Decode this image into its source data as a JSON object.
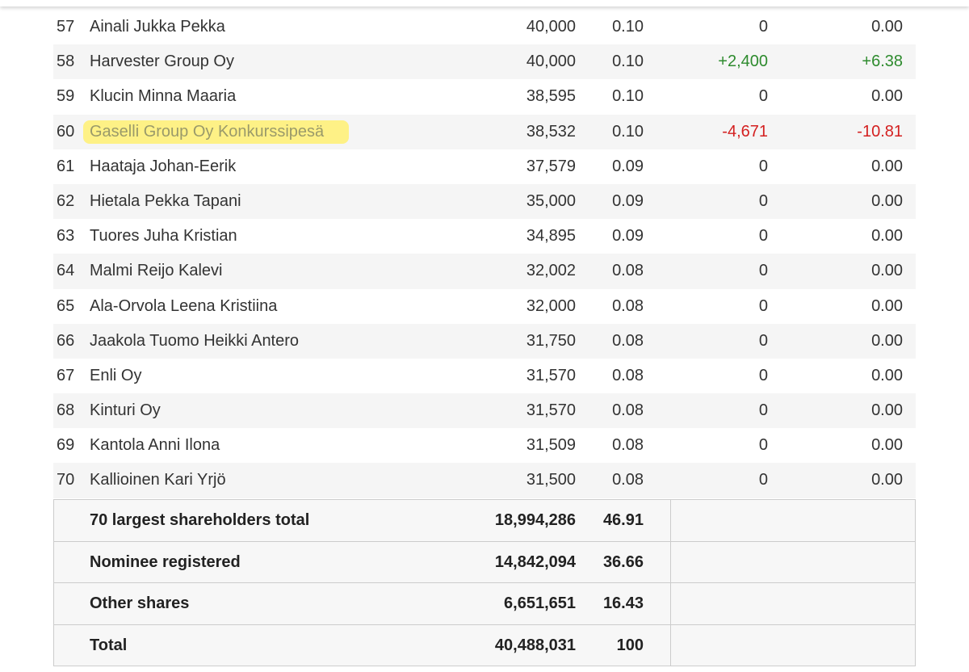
{
  "shareholders": [
    {
      "rank": "57",
      "name": "Ainali Jukka Pekka",
      "shares": "40,000",
      "pct": "0.10",
      "change": "0",
      "change_pct": "0.00",
      "trend": "flat"
    },
    {
      "rank": "58",
      "name": "Harvester Group Oy",
      "shares": "40,000",
      "pct": "0.10",
      "change": "+2,400",
      "change_pct": "+6.38",
      "trend": "pos"
    },
    {
      "rank": "59",
      "name": "Klucin Minna Maaria",
      "shares": "38,595",
      "pct": "0.10",
      "change": "0",
      "change_pct": "0.00",
      "trend": "flat"
    },
    {
      "rank": "60",
      "name": "Gaselli Group Oy Konkurssipesä",
      "shares": "38,532",
      "pct": "0.10",
      "change": "-4,671",
      "change_pct": "-10.81",
      "trend": "neg",
      "highlighted": true
    },
    {
      "rank": "61",
      "name": "Haataja Johan-Eerik",
      "shares": "37,579",
      "pct": "0.09",
      "change": "0",
      "change_pct": "0.00",
      "trend": "flat"
    },
    {
      "rank": "62",
      "name": "Hietala Pekka Tapani",
      "shares": "35,000",
      "pct": "0.09",
      "change": "0",
      "change_pct": "0.00",
      "trend": "flat"
    },
    {
      "rank": "63",
      "name": "Tuores Juha Kristian",
      "shares": "34,895",
      "pct": "0.09",
      "change": "0",
      "change_pct": "0.00",
      "trend": "flat"
    },
    {
      "rank": "64",
      "name": "Malmi Reijo Kalevi",
      "shares": "32,002",
      "pct": "0.08",
      "change": "0",
      "change_pct": "0.00",
      "trend": "flat"
    },
    {
      "rank": "65",
      "name": "Ala-Orvola Leena Kristiina",
      "shares": "32,000",
      "pct": "0.08",
      "change": "0",
      "change_pct": "0.00",
      "trend": "flat"
    },
    {
      "rank": "66",
      "name": "Jaakola Tuomo Heikki Antero",
      "shares": "31,750",
      "pct": "0.08",
      "change": "0",
      "change_pct": "0.00",
      "trend": "flat"
    },
    {
      "rank": "67",
      "name": "Enli Oy",
      "shares": "31,570",
      "pct": "0.08",
      "change": "0",
      "change_pct": "0.00",
      "trend": "flat"
    },
    {
      "rank": "68",
      "name": "Kinturi Oy",
      "shares": "31,570",
      "pct": "0.08",
      "change": "0",
      "change_pct": "0.00",
      "trend": "flat"
    },
    {
      "rank": "69",
      "name": "Kantola Anni Ilona",
      "shares": "31,509",
      "pct": "0.08",
      "change": "0",
      "change_pct": "0.00",
      "trend": "flat"
    },
    {
      "rank": "70",
      "name": "Kallioinen Kari Yrjö",
      "shares": "31,500",
      "pct": "0.08",
      "change": "0",
      "change_pct": "0.00",
      "trend": "flat"
    }
  ],
  "totals": [
    {
      "label": "70 largest shareholders total",
      "shares": "18,994,286",
      "pct": "46.91"
    },
    {
      "label": "Nominee registered",
      "shares": "14,842,094",
      "pct": "36.66"
    },
    {
      "label": "Other shares",
      "shares": "6,651,651",
      "pct": "16.43"
    },
    {
      "label": "Total",
      "shares": "40,488,031",
      "pct": "100"
    }
  ],
  "colors": {
    "positive": "#2e8b2e",
    "negative": "#d42020",
    "highlight": "#fff17a",
    "stripe": "#f5f5f5"
  }
}
